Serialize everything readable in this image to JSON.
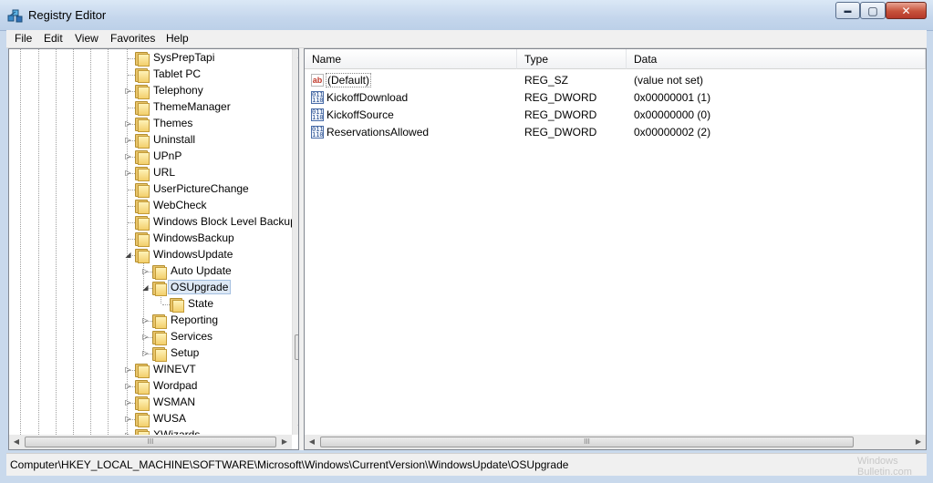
{
  "window": {
    "title": "Registry Editor",
    "controls": {
      "minimize": "▬",
      "maximize": "▢",
      "close": "✕"
    }
  },
  "menu": [
    "File",
    "Edit",
    "View",
    "Favorites",
    "Help"
  ],
  "tree": {
    "nodes": [
      {
        "label": "SysPrepTapi",
        "expander": ""
      },
      {
        "label": "Tablet PC",
        "expander": ""
      },
      {
        "label": "Telephony",
        "expander": "▷"
      },
      {
        "label": "ThemeManager",
        "expander": ""
      },
      {
        "label": "Themes",
        "expander": "▷"
      },
      {
        "label": "Uninstall",
        "expander": "▷"
      },
      {
        "label": "UPnP",
        "expander": "▷"
      },
      {
        "label": "URL",
        "expander": "▷"
      },
      {
        "label": "UserPictureChange",
        "expander": ""
      },
      {
        "label": "WebCheck",
        "expander": ""
      },
      {
        "label": "Windows Block Level Backup",
        "expander": ""
      },
      {
        "label": "WindowsBackup",
        "expander": ""
      },
      {
        "label": "WindowsUpdate",
        "expander": "◢"
      },
      {
        "label": "Auto Update",
        "expander": "▷"
      },
      {
        "label": "OSUpgrade",
        "expander": "◢",
        "selected": true
      },
      {
        "label": "State",
        "expander": ""
      },
      {
        "label": "Reporting",
        "expander": "▷"
      },
      {
        "label": "Services",
        "expander": "▷"
      },
      {
        "label": "Setup",
        "expander": "▷"
      },
      {
        "label": "WINEVT",
        "expander": "▷"
      },
      {
        "label": "Wordpad",
        "expander": "▷"
      },
      {
        "label": "WSMAN",
        "expander": "▷"
      },
      {
        "label": "WUSA",
        "expander": "▷"
      },
      {
        "label": "XWizards",
        "expander": "▷"
      }
    ]
  },
  "list": {
    "columns": [
      "Name",
      "Type",
      "Data"
    ],
    "rows": [
      {
        "icon": "string-value-icon",
        "icon_text": "ab",
        "name": "(Default)",
        "type": "REG_SZ",
        "data": "(value not set)"
      },
      {
        "icon": "dword-value-icon",
        "icon_text": "011 110",
        "name": "KickoffDownload",
        "type": "REG_DWORD",
        "data": "0x00000001 (1)"
      },
      {
        "icon": "dword-value-icon",
        "icon_text": "011 110",
        "name": "KickoffSource",
        "type": "REG_DWORD",
        "data": "0x00000000 (0)"
      },
      {
        "icon": "dword-value-icon",
        "icon_text": "011 110",
        "name": "ReservationsAllowed",
        "type": "REG_DWORD",
        "data": "0x00000002 (2)"
      }
    ]
  },
  "scroll": {
    "up_arrow": "▲",
    "down_arrow": "▼",
    "left_arrow": "◀",
    "right_arrow": "▶",
    "grip": "III"
  },
  "status": {
    "path": "Computer\\HKEY_LOCAL_MACHINE\\SOFTWARE\\Microsoft\\Windows\\CurrentVersion\\WindowsUpdate\\OSUpgrade"
  },
  "watermark": {
    "line1": "Windows",
    "line2": "Bulletin.com"
  }
}
